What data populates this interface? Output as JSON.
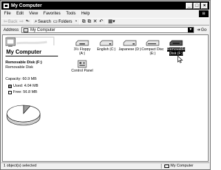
{
  "window": {
    "title": "My Computer"
  },
  "titlebar_buttons": {
    "minimize": "_",
    "maximize": "□",
    "close": "×"
  },
  "menu": [
    "File",
    "Edit",
    "View",
    "Favorites",
    "Tools",
    "Help"
  ],
  "toolbar": {
    "back": "Back",
    "search": "Search",
    "folders": "Folders"
  },
  "address": {
    "label": "Address",
    "value": "My Computer",
    "go": "Go"
  },
  "left_pane": {
    "title": "My Computer",
    "selected_name": "Removable Disk (F:)",
    "selected_type": "Removable Disk",
    "capacity": "Capacity: 60.9 MB",
    "used": "Used: 4.04 MB",
    "free": "Free: 56.8 MB"
  },
  "chart_data": {
    "type": "pie",
    "values": [
      4.04,
      56.8
    ],
    "labels": [
      "Used",
      "Free"
    ],
    "colors": [
      "#9b9b9b",
      "#ffffff"
    ]
  },
  "items": [
    {
      "label": "3½ Floppy (A:)",
      "icon": "floppy-drive-icon",
      "selected": false
    },
    {
      "label": "English (C:)",
      "icon": "hard-disk-icon",
      "selected": false
    },
    {
      "label": "Japanese (D:)",
      "icon": "hard-disk-icon",
      "selected": false
    },
    {
      "label": "Compact Disc (E:)",
      "icon": "cd-drive-icon",
      "selected": false
    },
    {
      "label": "Removable Disk (F:)",
      "icon": "removable-disk-icon",
      "selected": true
    },
    {
      "label": "Control Panel",
      "icon": "control-panel-icon",
      "selected": false
    }
  ],
  "status": {
    "left": "1 object(s) selected",
    "right": "My Computer"
  }
}
